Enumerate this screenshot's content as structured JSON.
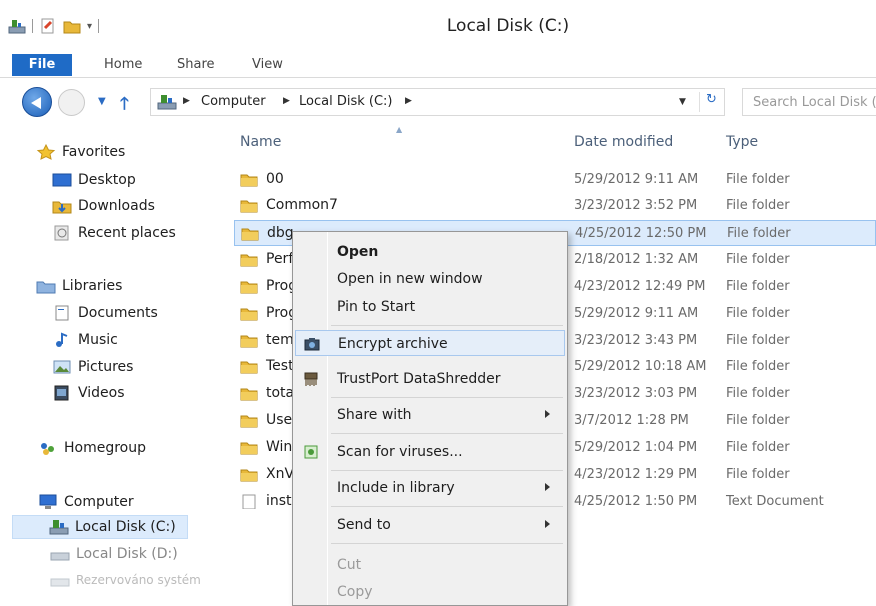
{
  "window": {
    "title": "Local Disk (C:)"
  },
  "ribbon": {
    "tabs": [
      "File",
      "Home",
      "Share",
      "View"
    ]
  },
  "address": {
    "crumbs": [
      "Computer",
      "Local Disk (C:)"
    ],
    "search_placeholder": "Search Local Disk (C:)"
  },
  "nav": {
    "favorites": "Favorites",
    "desktop": "Desktop",
    "downloads": "Downloads",
    "recent": "Recent places",
    "libraries": "Libraries",
    "documents": "Documents",
    "music": "Music",
    "pictures": "Pictures",
    "videos": "Videos",
    "homegroup": "Homegroup",
    "computer": "Computer",
    "local_c": "Local Disk (C:)",
    "local_d": "Local Disk (D:)",
    "reserved": "Rezervováno systém"
  },
  "columns": {
    "name": "Name",
    "date": "Date modified",
    "type": "Type"
  },
  "files": [
    {
      "name": "00",
      "date": "5/29/2012 9:11 AM",
      "type": "File folder"
    },
    {
      "name": "Common7",
      "date": "3/23/2012 3:52 PM",
      "type": "File folder"
    },
    {
      "name": "dbg",
      "date": "4/25/2012 12:50 PM",
      "type": "File folder"
    },
    {
      "name": "Perf",
      "date": "2/18/2012 1:32 AM",
      "type": "File folder"
    },
    {
      "name": "Prog",
      "date": "4/23/2012 12:49 PM",
      "type": "File folder"
    },
    {
      "name": "Prog",
      "date": "5/29/2012 9:11 AM",
      "type": "File folder"
    },
    {
      "name": "tem",
      "date": "3/23/2012 3:43 PM",
      "type": "File folder"
    },
    {
      "name": "Test",
      "date": "5/29/2012 10:18 AM",
      "type": "File folder"
    },
    {
      "name": "tota",
      "date": "3/23/2012 3:03 PM",
      "type": "File folder"
    },
    {
      "name": "User",
      "date": "3/7/2012 1:28 PM",
      "type": "File folder"
    },
    {
      "name": "Win",
      "date": "5/29/2012 1:04 PM",
      "type": "File folder"
    },
    {
      "name": "XnV",
      "date": "4/23/2012 1:29 PM",
      "type": "File folder"
    },
    {
      "name": "inst",
      "date": "4/25/2012 1:50 PM",
      "type": "Text Document"
    }
  ],
  "context_menu": {
    "open": "Open",
    "open_new_window": "Open in new window",
    "pin_to_start": "Pin to Start",
    "encrypt_archive": "Encrypt archive",
    "trustport_shredder": "TrustPort DataShredder",
    "share_with": "Share with",
    "scan_viruses": "Scan for viruses...",
    "include_library": "Include in library",
    "send_to": "Send to",
    "cut": "Cut",
    "copy": "Copy"
  },
  "colors": {
    "accent": "#1f6bc6",
    "selection": "#dcebfc",
    "folder": "#e8b83a"
  }
}
